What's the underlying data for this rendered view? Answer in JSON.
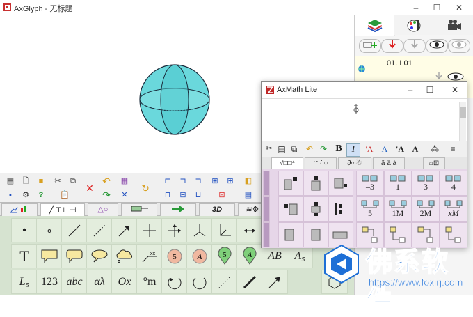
{
  "window": {
    "title": "AxGlyph - 无标题",
    "minimize": "–",
    "maximize": "☐",
    "close": "✕"
  },
  "right_panel": {
    "layer_name": "01. L01"
  },
  "symbol_tabs": [
    "",
    "",
    "T",
    "△○",
    "",
    "",
    "3D",
    ""
  ],
  "palette": {
    "row1": [
      "•",
      "∘",
      "",
      "",
      "",
      "",
      "",
      "",
      "",
      ""
    ],
    "row2": [
      "T",
      "",
      "",
      "",
      "",
      "",
      "5",
      "A",
      "5",
      "A",
      "AB",
      "A₅"
    ],
    "row3": [
      "L₅",
      "123",
      "abc",
      "αλ",
      "Ox",
      "°m",
      "",
      "",
      "",
      "",
      ""
    ]
  },
  "axmath": {
    "title": "AxMath Lite",
    "minimize": "–",
    "maximize": "☐",
    "close": "✕",
    "bold": "B",
    "italic": "I",
    "tabs": [
      "√□□⁴",
      "",
      "∂∞☃",
      "ã ä ȧ",
      "⊙⊕"
    ],
    "grid": {
      "r1": [
        "–3",
        "1",
        "3",
        "4"
      ],
      "r2": [
        "5",
        "1M",
        "2M",
        "xM"
      ]
    }
  },
  "watermark": {
    "text": "佛系软件",
    "url": "https://www.foxirj.com"
  },
  "colors": {
    "sphere_fill": "#6ad8dc",
    "sphere_stroke": "#1a2a3a",
    "palette_bg": "#d6e3d0",
    "axmath_grid_bg": "#e6d6e8",
    "watermark_blue": "#1e6fd6"
  }
}
